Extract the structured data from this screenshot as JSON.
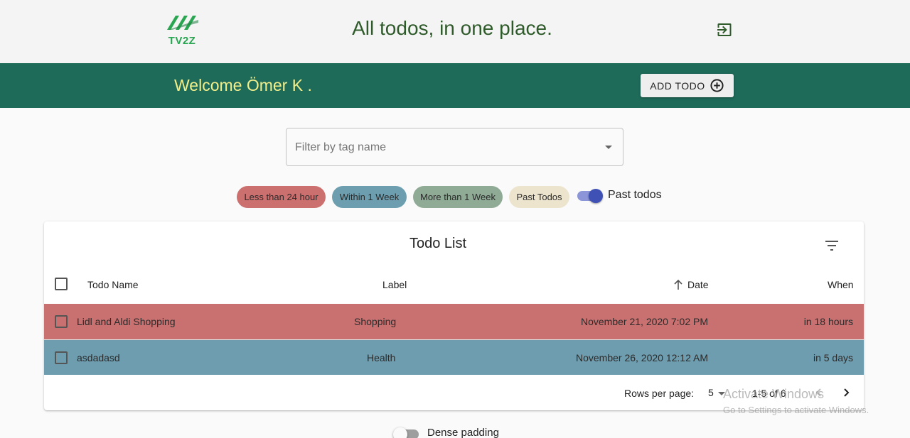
{
  "header": {
    "logo_text": "TV2Z",
    "headline": "All todos, in one place.",
    "logout_icon": "logout-icon"
  },
  "band": {
    "welcome": "Welcome Ömer K .",
    "add_button": "ADD TODO",
    "add_icon": "plus-circle-icon"
  },
  "filter": {
    "placeholder": "Filter by tag name"
  },
  "chips": [
    {
      "label": "Less than 24 hour",
      "color": "#cc6f6f"
    },
    {
      "label": "Within 1 Week",
      "color": "#6d9eaf"
    },
    {
      "label": "More than 1 Week",
      "color": "#8faa95"
    },
    {
      "label": "Past Todos",
      "color": "#ece4cd"
    }
  ],
  "past_toggle": {
    "label": "Past todos",
    "on": true
  },
  "table": {
    "title": "Todo List",
    "columns": [
      "Todo Name",
      "Label",
      "Date",
      "When"
    ],
    "rows": [
      {
        "name": "Lidl and Aldi Shopping",
        "label": "Shopping",
        "date": "November 21, 2020 7:02 PM",
        "when": "in 18 hours",
        "color": "#c87170"
      },
      {
        "name": "asdadasd",
        "label": "Health",
        "date": "November 26, 2020 12:12 AM",
        "when": "in 5 days",
        "color": "#6e9daf"
      }
    ],
    "pagination": {
      "rows_per_page_label": "Rows per page:",
      "rows_per_page": "5",
      "range": "1-5 of 6"
    }
  },
  "watermark": {
    "line1": "Activate Windows",
    "line2": "Go to Settings to activate Windows."
  },
  "dense": {
    "label": "Dense padding",
    "on": false
  }
}
